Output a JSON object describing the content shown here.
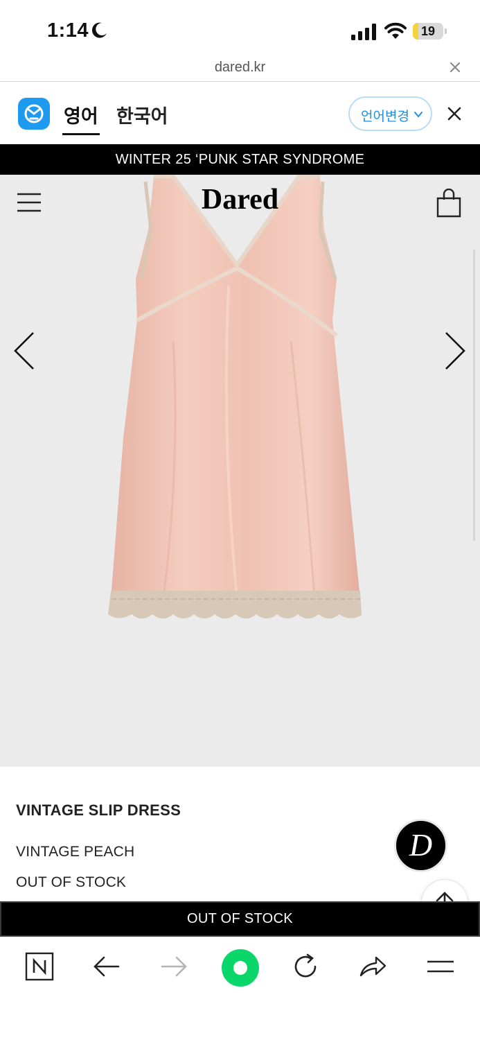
{
  "status_bar": {
    "time": "1:14",
    "battery_level": "19",
    "battery_fraction": 0.19
  },
  "browser": {
    "url": "dared.kr"
  },
  "translate_bar": {
    "tab_english": "영어",
    "tab_korean": "한국어",
    "change_language_label": "언어변경"
  },
  "announcement": "WINTER 25 ‘PUNK STAR SYNDROME",
  "header": {
    "brand": "Dared"
  },
  "product": {
    "name": "VINTAGE SLIP DRESS",
    "color": "VINTAGE PEACH",
    "status": "OUT OF STOCK",
    "image_alt_icon": "slip-dress-image"
  },
  "action_bar": {
    "label": "OUT OF STOCK"
  },
  "chat_button": {
    "glyph": "D"
  },
  "colors": {
    "announcement_bg": "#000000",
    "papago_blue": "#1e9bf0",
    "naver_green": "#0ad66a",
    "product_bg": "#ebebeb",
    "dress_color": "#f2c4b6"
  },
  "toolbar": {
    "icons": [
      "naver-home-icon",
      "back-icon",
      "forward-icon",
      "green-dot-icon",
      "reload-icon",
      "share-icon",
      "menu-icon"
    ]
  }
}
